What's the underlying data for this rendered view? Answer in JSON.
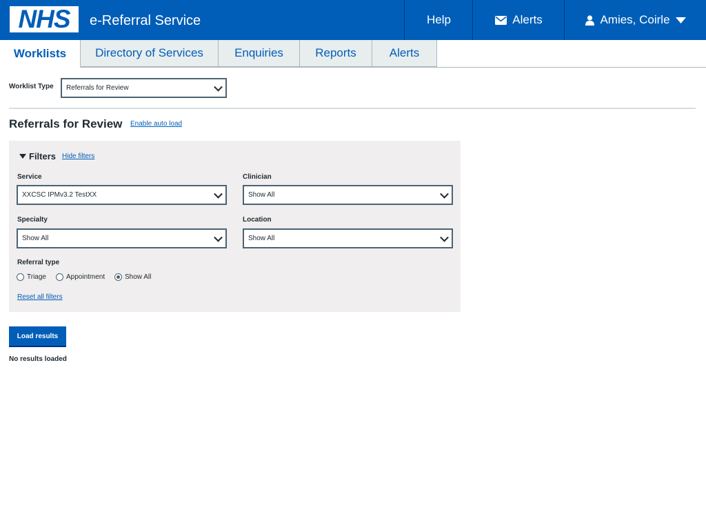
{
  "header": {
    "logo": "NHS",
    "service_name": "e-Referral Service",
    "help_label": "Help",
    "alerts_label": "Alerts",
    "user_name": "Amies, Coirle"
  },
  "tabs": [
    {
      "label": "Worklists",
      "active": true
    },
    {
      "label": "Directory of Services",
      "active": false
    },
    {
      "label": "Enquiries",
      "active": false
    },
    {
      "label": "Reports",
      "active": false
    },
    {
      "label": "Alerts",
      "active": false
    }
  ],
  "worklist": {
    "type_label": "Worklist Type",
    "type_value": "Referrals for Review"
  },
  "page": {
    "title": "Referrals for Review",
    "auto_load_link": "Enable auto load"
  },
  "filters": {
    "heading": "Filters",
    "hide_link": "Hide filters",
    "service_label": "Service",
    "service_value": "XXCSC IPMv3.2 TestXX",
    "clinician_label": "Clinician",
    "clinician_value": "Show All",
    "specialty_label": "Specialty",
    "specialty_value": "Show All",
    "location_label": "Location",
    "location_value": "Show All",
    "referral_type_label": "Referral type",
    "referral_types": [
      {
        "label": "Triage",
        "checked": false
      },
      {
        "label": "Appointment",
        "checked": false
      },
      {
        "label": "Show All",
        "checked": true
      }
    ],
    "reset_link": "Reset all filters"
  },
  "actions": {
    "load_results": "Load results"
  },
  "status": {
    "no_results": "No results loaded"
  },
  "colors": {
    "nhs_blue": "#005eb8",
    "panel_grey": "#f0eeee",
    "tab_grey": "#e8edee"
  }
}
